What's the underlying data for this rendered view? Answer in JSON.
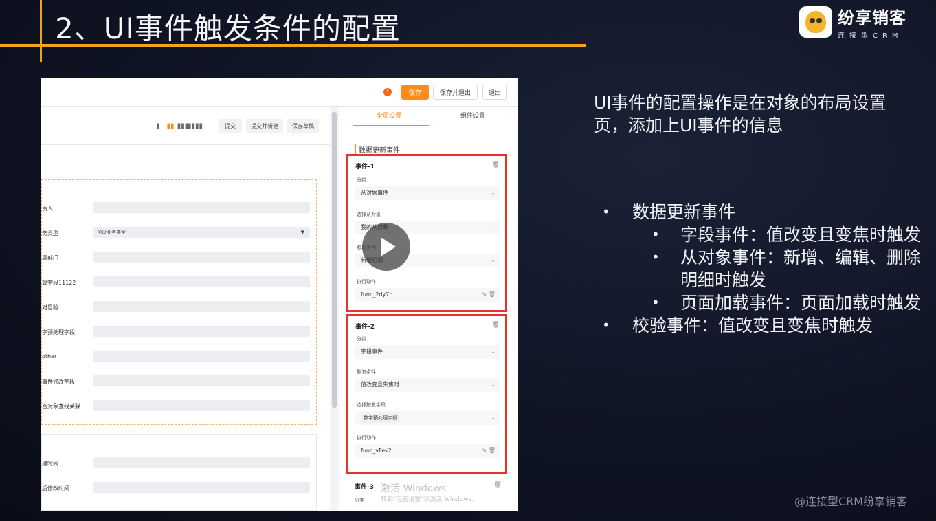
{
  "slide": {
    "title": "2、UI事件触发条件的配置",
    "logo_name": "纷享销客",
    "logo_sub": "连接型CRM",
    "description": "UI事件的配置操作是在对象的布局设置页，添加上UI事件的信息",
    "bullets": [
      {
        "text": "数据更新事件",
        "level": 1
      },
      {
        "text": "字段事件：值改变且变焦时触发",
        "level": 2
      },
      {
        "text": "从对象事件：新增、编辑、删除明细时触发",
        "level": 2
      },
      {
        "text": "页面加载事件：页面加载时触发",
        "level": 2
      },
      {
        "text": "校验事件：值改变且变焦时触发",
        "level": 1
      }
    ],
    "credit": "@连接型CRM纷享销客",
    "accent_color": "#f3a41a"
  },
  "screenshot": {
    "top_buttons": {
      "warn": "!",
      "save": "保存",
      "save_exit": "保存并退出",
      "exit": "退出"
    },
    "toolbar": {
      "layout_icons": [
        "▮",
        "▮▮",
        "▮▮▮",
        "▮▮▮▮"
      ],
      "submit": "提交",
      "submit_new": "提交并新建",
      "save_draft": "保存草稿"
    },
    "fields": [
      {
        "label": "责人",
        "value": ""
      },
      {
        "label": "务类型",
        "value": "预设业务类型",
        "has_caret": true
      },
      {
        "label": "属部门",
        "value": ""
      },
      {
        "label": "算字段11122",
        "value": ""
      },
      {
        "label": "对冒险",
        "value": ""
      },
      {
        "label": "字预处理字段",
        "value": ""
      },
      {
        "label": "other",
        "value": ""
      },
      {
        "label": "事件修改字段",
        "value": ""
      },
      {
        "label": "合对象查找关联",
        "value": ""
      }
    ],
    "fields2": [
      {
        "label": "建时间",
        "value": ""
      },
      {
        "label": "后修改时间",
        "value": ""
      }
    ],
    "right_tabs": {
      "global": "全局设置",
      "component": "组件设置"
    },
    "section_title": "数据更新事件",
    "event1": {
      "title": "事件-1",
      "category_label": "分类",
      "category_value": "从对象事件",
      "child_label": "选择从对象",
      "child_value": "我的从对象",
      "trigger_label": "触发条件",
      "trigger_value": "新增明细",
      "action_label": "执行动作",
      "action_value": "func_2dy7h"
    },
    "event2": {
      "title": "事件-2",
      "category_label": "分类",
      "category_value": "字段事件",
      "trigger_label": "触发条件",
      "trigger_value": "值改变且失焦时",
      "field_label": "选择触发字段",
      "field_tag": "数字预处理字段",
      "action_label": "执行动作",
      "action_value": "func_vFek2"
    },
    "event3": {
      "title": "事件-3",
      "category_label": "分类"
    },
    "windows_watermark": "激活 Windows",
    "windows_watermark_sub": "转到\"电脑设置\"以激活 Windows。"
  }
}
